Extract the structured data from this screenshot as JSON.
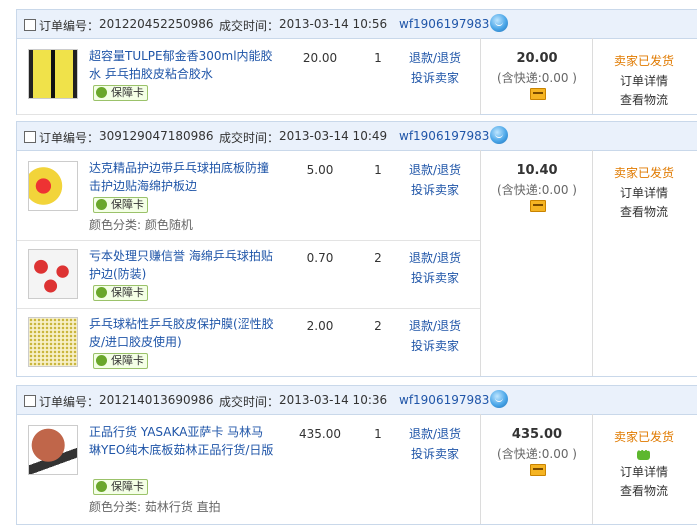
{
  "labels": {
    "order_no": "订单编号：",
    "deal_time": "成交时间：",
    "guarantee": "保障卡",
    "refund": "退款/退货",
    "complain": "投诉卖家",
    "shipping_fee": "(含快递:0.00 )",
    "status_shipped": "卖家已发货",
    "order_detail": "订单详情",
    "view_logistics": "查看物流"
  },
  "colors": {
    "link": "#1f55a8",
    "status": "#e07a00",
    "header_bg": "#eaf1fb"
  },
  "orders": [
    {
      "order_no": "201220452250986",
      "deal_time": "2013-03-14 10:56",
      "seller": "wf1906197983",
      "total": "20.00",
      "items": [
        {
          "title": "超容量TULPE郁金香300ml内能胶水 乒乓拍胶皮粘合胶水",
          "price": "20.00",
          "qty": "1",
          "attr": ""
        }
      ]
    },
    {
      "order_no": "309129047180986",
      "deal_time": "2013-03-14 10:49",
      "seller": "wf1906197983",
      "total": "10.40",
      "items": [
        {
          "title": "达克精品护边带乒乓球拍底板防撞击护边贴海绵护板边",
          "price": "5.00",
          "qty": "1",
          "attr": "颜色分类: 颜色随机"
        },
        {
          "title": "亏本处理只赚信誉 海绵乒乓球拍贴护边(防装)",
          "price": "0.70",
          "qty": "2",
          "attr": ""
        },
        {
          "title": "乒乓球粘性乒乓胶皮保护膜(涩性胶皮/进口胶皮使用)",
          "price": "2.00",
          "qty": "2",
          "attr": ""
        }
      ]
    },
    {
      "order_no": "201214013690986",
      "deal_time": "2013-03-14 10:36",
      "seller": "wf1906197983",
      "total": "435.00",
      "items": [
        {
          "title": "正品行货 YASAKA亚萨卡 马林马琳YEO纯木底板茹林正品行货/日版",
          "price": "435.00",
          "qty": "1",
          "attr": "颜色分类: 茹林行货 直拍"
        }
      ]
    }
  ]
}
